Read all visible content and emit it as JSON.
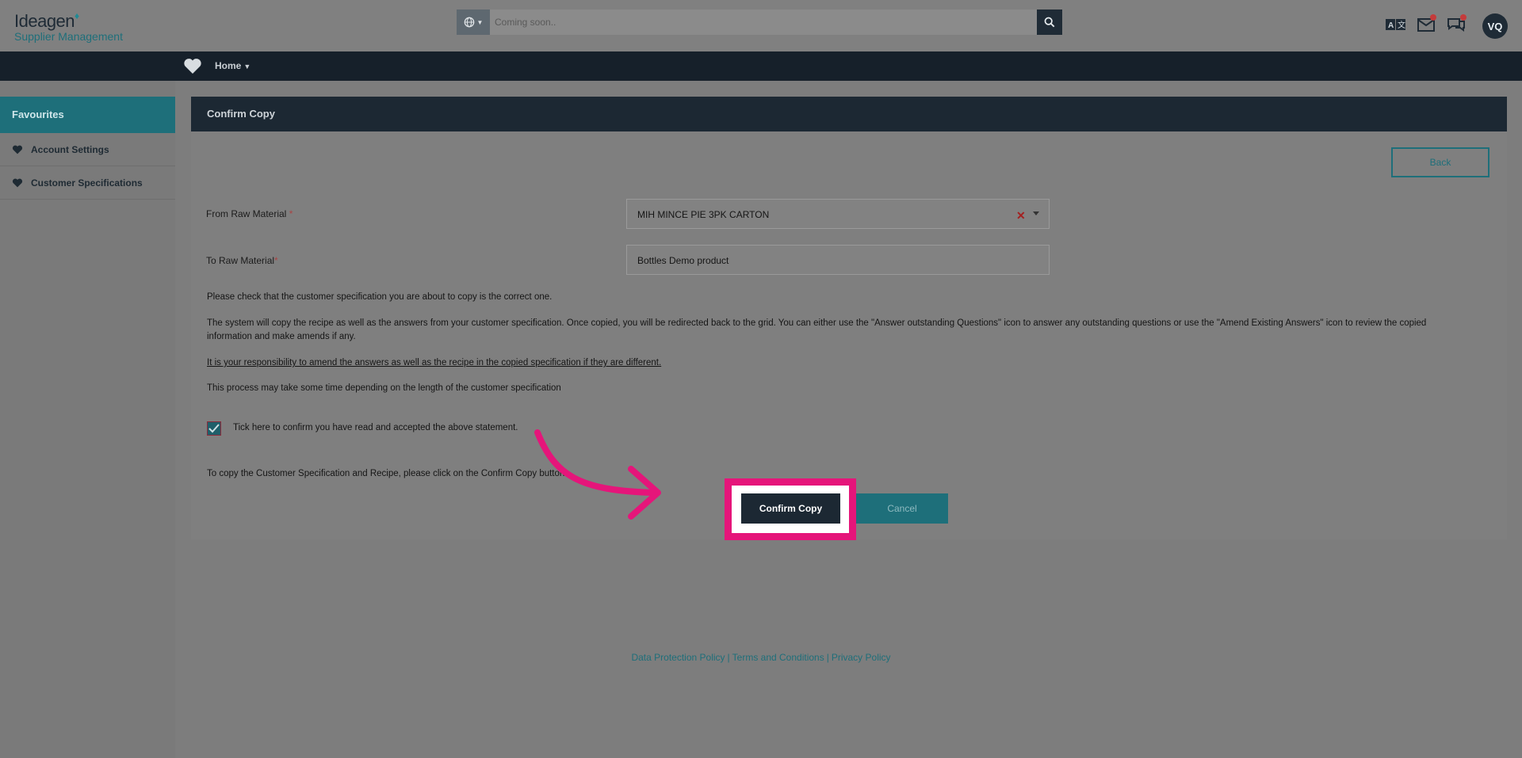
{
  "header": {
    "logo_text": "Ideagen",
    "logo_subtitle": "Supplier Management",
    "search": {
      "placeholder": "Coming soon.."
    },
    "icons": [
      "translate-icon",
      "mail-icon",
      "chat-icon"
    ],
    "avatar_initials": "VQ"
  },
  "nav": {
    "home_label": "Home"
  },
  "sidebar": {
    "title": "Favourites",
    "items": [
      {
        "label": "Account Settings",
        "icon": "heart-icon"
      },
      {
        "label": "Customer Specifications",
        "icon": "heart-icon"
      }
    ]
  },
  "panel": {
    "title": "Confirm Copy",
    "back_label": "Back",
    "from_label": "From Raw Material",
    "from_value": "MIH MINCE PIE 3PK CARTON",
    "to_label": "To Raw Material",
    "to_value": "Bottles Demo product",
    "para1": "Please check that the customer specification you are about to copy is the correct one.",
    "para2a": "The system will copy the recipe as well as the answers from your customer specification. Once copied, you will be redirected back to the grid. You can either use the \"Answer outstanding Questions\" icon to answer any outstanding questions or use the \"Amend Existing Answers\" icon to review the copied",
    "para2b": "information and make amends if any.",
    "para3": "It is your responsibility to amend the answers as well as the recipe in the copied specification if they are different.",
    "para4": "This process may take some time depending on the length of the customer specification",
    "checkbox_label": "Tick here to confirm you have read and accepted the above statement.",
    "checkbox_checked": true,
    "instruction": "To copy the Customer Specification and Recipe, please click on the Confirm Copy button.",
    "confirm_label": "Confirm Copy",
    "cancel_label": "Cancel"
  },
  "footer": {
    "links": [
      "Data Protection Policy",
      "Terms and Conditions",
      "Privacy Policy"
    ],
    "separator": "|"
  },
  "colors": {
    "accent": "#1e6f7a",
    "dark": "#1c2833",
    "highlight": "#e5157a"
  }
}
